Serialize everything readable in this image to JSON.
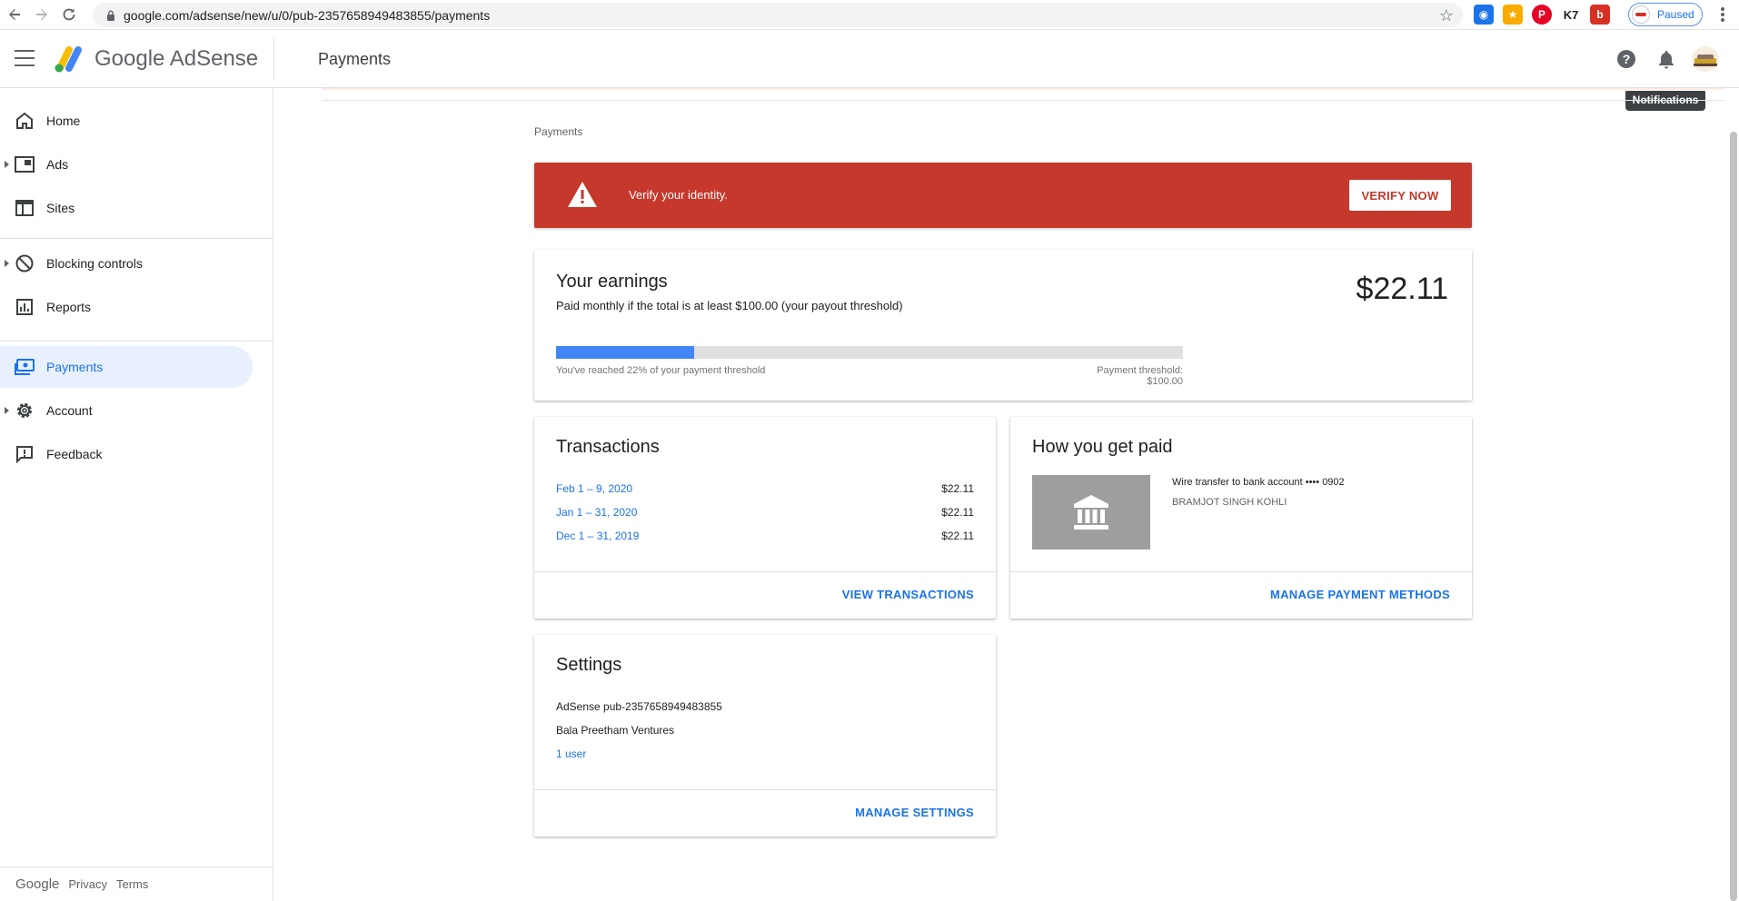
{
  "browser": {
    "url": "google.com/adsense/new/u/0/pub-2357658949483855/payments",
    "profile_status": "Paused",
    "extensions": [
      {
        "name": "ext-1",
        "color": "#1a73e8",
        "glyph": "◉"
      },
      {
        "name": "ext-2",
        "color": "#f9ab00",
        "glyph": "★"
      },
      {
        "name": "pinterest",
        "color": "#e60023",
        "glyph": "P"
      },
      {
        "name": "k7",
        "color": "#202124",
        "glyph": "K7"
      },
      {
        "name": "ext-5",
        "color": "#d93025",
        "glyph": "b"
      }
    ]
  },
  "header": {
    "app_name": "Google AdSense",
    "page_title": "Payments",
    "tooltip": "Notifications"
  },
  "sidebar": {
    "items": [
      {
        "label": "Home",
        "icon": "home-icon"
      },
      {
        "label": "Ads",
        "icon": "ads-icon"
      },
      {
        "label": "Sites",
        "icon": "sites-icon"
      },
      {
        "label": "Blocking controls",
        "icon": "block-icon"
      },
      {
        "label": "Reports",
        "icon": "reports-icon"
      },
      {
        "label": "Payments",
        "icon": "payments-icon"
      },
      {
        "label": "Account",
        "icon": "gear-icon"
      },
      {
        "label": "Feedback",
        "icon": "feedback-icon"
      }
    ],
    "footer": {
      "google": "Google",
      "privacy": "Privacy",
      "terms": "Terms"
    }
  },
  "main": {
    "breadcrumb": "Payments",
    "alert": {
      "text": "Verify your identity.",
      "button": "VERIFY NOW"
    },
    "earnings": {
      "title": "Your earnings",
      "subtitle": "Paid monthly if the total is at least $100.00 (your payout threshold)",
      "amount": "$22.11",
      "progress_percent": 22,
      "reached_text": "You've reached 22% of your payment threshold",
      "threshold_text": "Payment threshold: $100.00"
    },
    "transactions": {
      "title": "Transactions",
      "rows": [
        {
          "date": "Feb 1 – 9, 2020",
          "amount": "$22.11"
        },
        {
          "date": "Jan 1 – 31, 2020",
          "amount": "$22.11"
        },
        {
          "date": "Dec 1 – 31, 2019",
          "amount": "$22.11"
        }
      ],
      "link": "VIEW TRANSACTIONS"
    },
    "how_paid": {
      "title": "How you get paid",
      "method": "Wire transfer to bank account •••• 0902",
      "holder": "BRAMJOT SINGH KOHLI",
      "link": "MANAGE PAYMENT METHODS"
    },
    "settings": {
      "title": "Settings",
      "publisher": "AdSense pub-2357658949483855",
      "company": "Bala Preetham Ventures",
      "users": "1 user",
      "link": "MANAGE SETTINGS"
    }
  },
  "colors": {
    "accent": "#1a73e8",
    "alert": "#c5382b",
    "progress": "#4285f4"
  }
}
